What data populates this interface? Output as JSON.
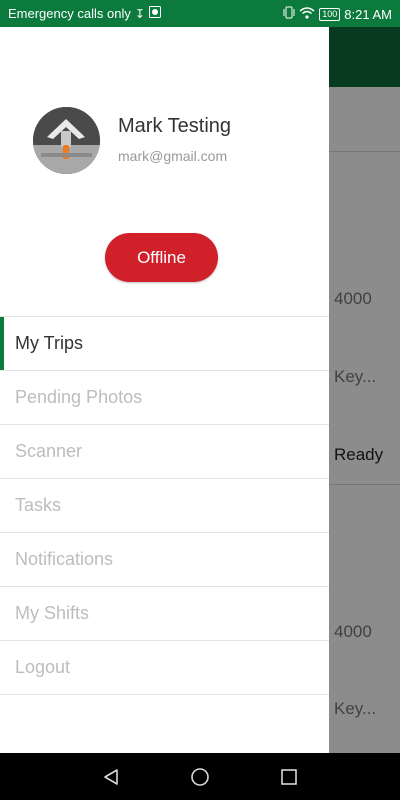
{
  "status_bar": {
    "carrier_text": "Emergency calls only",
    "time": "8:21 AM",
    "battery_level": "100",
    "icons": [
      "usb-icon",
      "app-notification-icon",
      "vibrate-icon",
      "wifi-icon",
      "battery-icon"
    ]
  },
  "background": {
    "toolbar_color": "#0f6b3a",
    "texts": [
      "4000",
      "Key...",
      "Ready",
      "4000",
      "Key..."
    ]
  },
  "drawer": {
    "user": {
      "name": "Mark Testing",
      "email": "mark@gmail.com"
    },
    "status_button": {
      "label": "Offline",
      "color": "#d0202a"
    },
    "menu": [
      {
        "label": "My Trips",
        "active": true
      },
      {
        "label": "Pending Photos",
        "active": false
      },
      {
        "label": "Scanner",
        "active": false
      },
      {
        "label": "Tasks",
        "active": false
      },
      {
        "label": "Notifications",
        "active": false
      },
      {
        "label": "My Shifts",
        "active": false
      },
      {
        "label": "Logout",
        "active": false
      }
    ],
    "accent_color": "#0d7a3d"
  },
  "nav_bar": {
    "icons": [
      "back-icon",
      "home-icon",
      "recents-icon"
    ]
  }
}
